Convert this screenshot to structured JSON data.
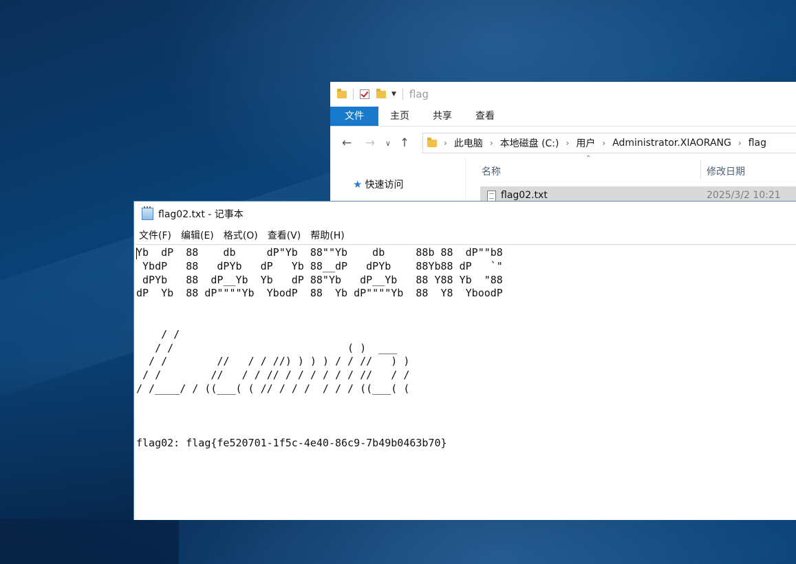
{
  "explorer": {
    "title": "flag",
    "tabs": [
      "文件",
      "主页",
      "共享",
      "查看"
    ],
    "breadcrumbs": [
      "此电脑",
      "本地磁盘 (C:)",
      "用户",
      "Administrator.XIAORANG",
      "flag"
    ],
    "nav_quick_access": "快速访问",
    "columns": {
      "name": "名称",
      "modified": "修改日期"
    },
    "file": {
      "name": "flag02.txt",
      "modified": "2025/3/2 10:21"
    }
  },
  "notepad": {
    "title": "flag02.txt - 记事本",
    "menus": [
      "文件(F)",
      "编辑(E)",
      "格式(O)",
      "查看(V)",
      "帮助(H)"
    ],
    "content": "Yb  dP  88    db     dP\"Yb  88\"\"Yb    db     88b 88  dP\"\"b8\n YbdP   88   dPYb   dP   Yb 88__dP   dPYb    88Yb88 dP   `\"\n dPYb   88  dP__Yb  Yb   dP 88\"Yb   dP__Yb   88 Y88 Yb  \"88\ndP  Yb  88 dP\"\"\"\"Yb  YbodP  88  Yb dP\"\"\"\"Yb  88  Y8  YboodP\n\n\n    / /\n   / /                            ( )  ___\n  / /        //   / / //) ) ) ) / / //   ) )\n / /        //   / / // / / / / / / //   / /\n/ /____/ / ((___( ( // / / /  / / / ((___( (\n\n\n\nflag02: flag{fe520701-1f5c-4e40-86c9-7b49b0463b70}"
  }
}
